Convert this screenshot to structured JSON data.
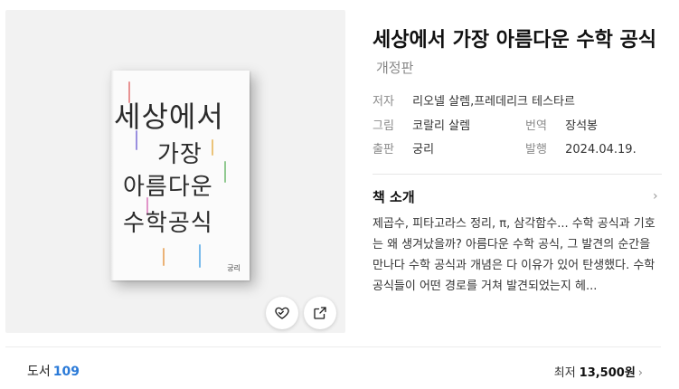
{
  "book": {
    "title": "세상에서 가장 아름다운 수학 공식",
    "edition": "개정판",
    "cover": {
      "line1": "세상에서",
      "line2": "가장",
      "line3": "아름다운",
      "line4": "수학공식",
      "publisher_mark": "궁리"
    },
    "meta": {
      "author_label": "저자",
      "author": "리오넬 살렘,프레데리크 테스타르",
      "illustrator_label": "그림",
      "illustrator": "코랄리 살렘",
      "translator_label": "번역",
      "translator": "장석봉",
      "publisher_label": "출판",
      "publisher": "궁리",
      "date_label": "발행",
      "date": "2024.04.19."
    },
    "intro": {
      "heading": "책 소개",
      "text": "제곱수, 피타고라스 정리, π, 삼각함수... 수학 공식과 기호는 왜 생겨났을까? 아름다운 수학 공식, 그 발견의 순간을 만나다 수학 공식과 개념은 다 이유가 있어 탄생했다. 수학 공식들이 어떤 경로를 거쳐 발견되었는지 헤..."
    }
  },
  "icons": {
    "like": "heart-icon",
    "share": "share-icon",
    "chevron": "chevron-right-icon"
  },
  "footer": {
    "category_label": "도서",
    "category_count": "109",
    "price_prefix": "최저",
    "price": "13,500원"
  }
}
